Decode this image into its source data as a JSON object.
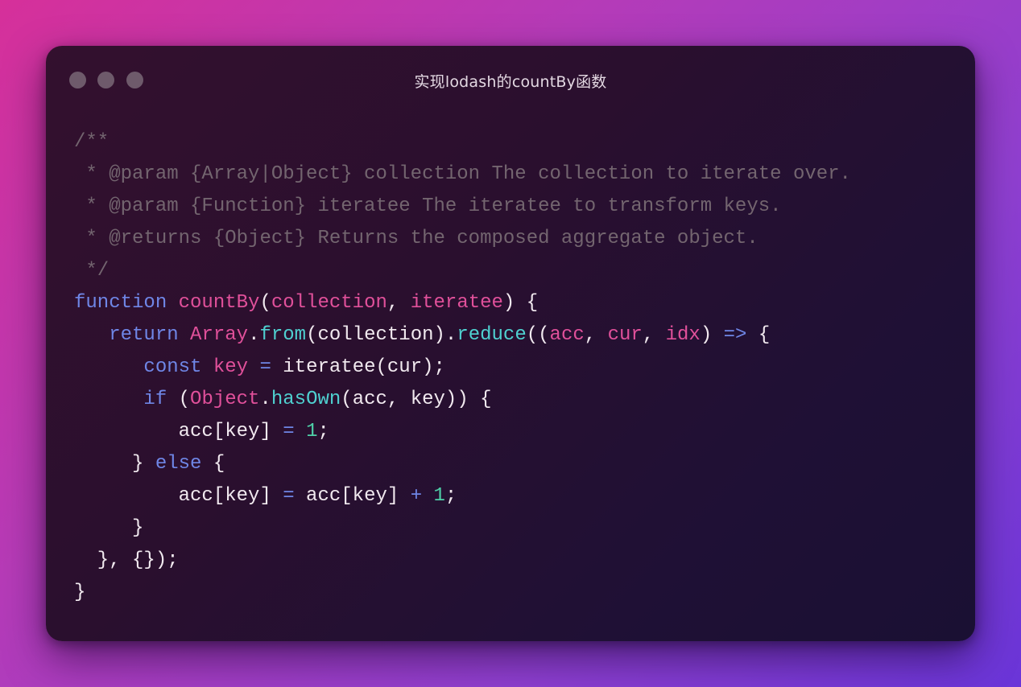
{
  "window": {
    "title": "实现lodash的countBy函数"
  },
  "colors": {
    "comment": "#73656f",
    "keyword": "#6f86e6",
    "function_name": "#e0509a",
    "parameter": "#e0509a",
    "method": "#4fd0d0",
    "number": "#4fd0a8",
    "plain": "#f1e9ef"
  },
  "code": {
    "lines": [
      [
        {
          "t": "/**",
          "c": "comment"
        }
      ],
      [
        {
          "t": " * @param {Array|Object} collection The collection to iterate over.",
          "c": "comment"
        }
      ],
      [
        {
          "t": " * @param {Function} iteratee The iteratee to transform keys.",
          "c": "comment"
        }
      ],
      [
        {
          "t": " * @returns {Object} Returns the composed aggregate object.",
          "c": "comment"
        }
      ],
      [
        {
          "t": " */",
          "c": "comment"
        }
      ],
      [
        {
          "t": "function",
          "c": "kw"
        },
        {
          "t": " ",
          "c": "plain"
        },
        {
          "t": "countBy",
          "c": "fn"
        },
        {
          "t": "(",
          "c": "punct"
        },
        {
          "t": "collection",
          "c": "param"
        },
        {
          "t": ", ",
          "c": "punct"
        },
        {
          "t": "iteratee",
          "c": "param"
        },
        {
          "t": ") {",
          "c": "punct"
        }
      ],
      [
        {
          "t": "   ",
          "c": "plain"
        },
        {
          "t": "return",
          "c": "kw"
        },
        {
          "t": " ",
          "c": "plain"
        },
        {
          "t": "Array",
          "c": "class"
        },
        {
          "t": ".",
          "c": "punct"
        },
        {
          "t": "from",
          "c": "method"
        },
        {
          "t": "(collection).",
          "c": "plain"
        },
        {
          "t": "reduce",
          "c": "method"
        },
        {
          "t": "((",
          "c": "punct"
        },
        {
          "t": "acc",
          "c": "param"
        },
        {
          "t": ", ",
          "c": "punct"
        },
        {
          "t": "cur",
          "c": "param"
        },
        {
          "t": ", ",
          "c": "punct"
        },
        {
          "t": "idx",
          "c": "param"
        },
        {
          "t": ") ",
          "c": "punct"
        },
        {
          "t": "=>",
          "c": "op"
        },
        {
          "t": " {",
          "c": "punct"
        }
      ],
      [
        {
          "t": "      ",
          "c": "plain"
        },
        {
          "t": "const",
          "c": "kw"
        },
        {
          "t": " ",
          "c": "plain"
        },
        {
          "t": "key",
          "c": "param"
        },
        {
          "t": " ",
          "c": "plain"
        },
        {
          "t": "=",
          "c": "op"
        },
        {
          "t": " iteratee(cur);",
          "c": "plain"
        }
      ],
      [
        {
          "t": "      ",
          "c": "plain"
        },
        {
          "t": "if",
          "c": "kw"
        },
        {
          "t": " (",
          "c": "punct"
        },
        {
          "t": "Object",
          "c": "class"
        },
        {
          "t": ".",
          "c": "punct"
        },
        {
          "t": "hasOwn",
          "c": "method"
        },
        {
          "t": "(acc, key)) {",
          "c": "plain"
        }
      ],
      [
        {
          "t": "         acc[key] ",
          "c": "plain"
        },
        {
          "t": "=",
          "c": "op"
        },
        {
          "t": " ",
          "c": "plain"
        },
        {
          "t": "1",
          "c": "num"
        },
        {
          "t": ";",
          "c": "plain"
        }
      ],
      [
        {
          "t": "     } ",
          "c": "plain"
        },
        {
          "t": "else",
          "c": "kw"
        },
        {
          "t": " {",
          "c": "plain"
        }
      ],
      [
        {
          "t": "         acc[key] ",
          "c": "plain"
        },
        {
          "t": "=",
          "c": "op"
        },
        {
          "t": " acc[key] ",
          "c": "plain"
        },
        {
          "t": "+",
          "c": "op"
        },
        {
          "t": " ",
          "c": "plain"
        },
        {
          "t": "1",
          "c": "num"
        },
        {
          "t": ";",
          "c": "plain"
        }
      ],
      [
        {
          "t": "     }",
          "c": "plain"
        }
      ],
      [
        {
          "t": "  }, {});",
          "c": "plain"
        }
      ],
      [
        {
          "t": "}",
          "c": "plain"
        }
      ]
    ]
  }
}
